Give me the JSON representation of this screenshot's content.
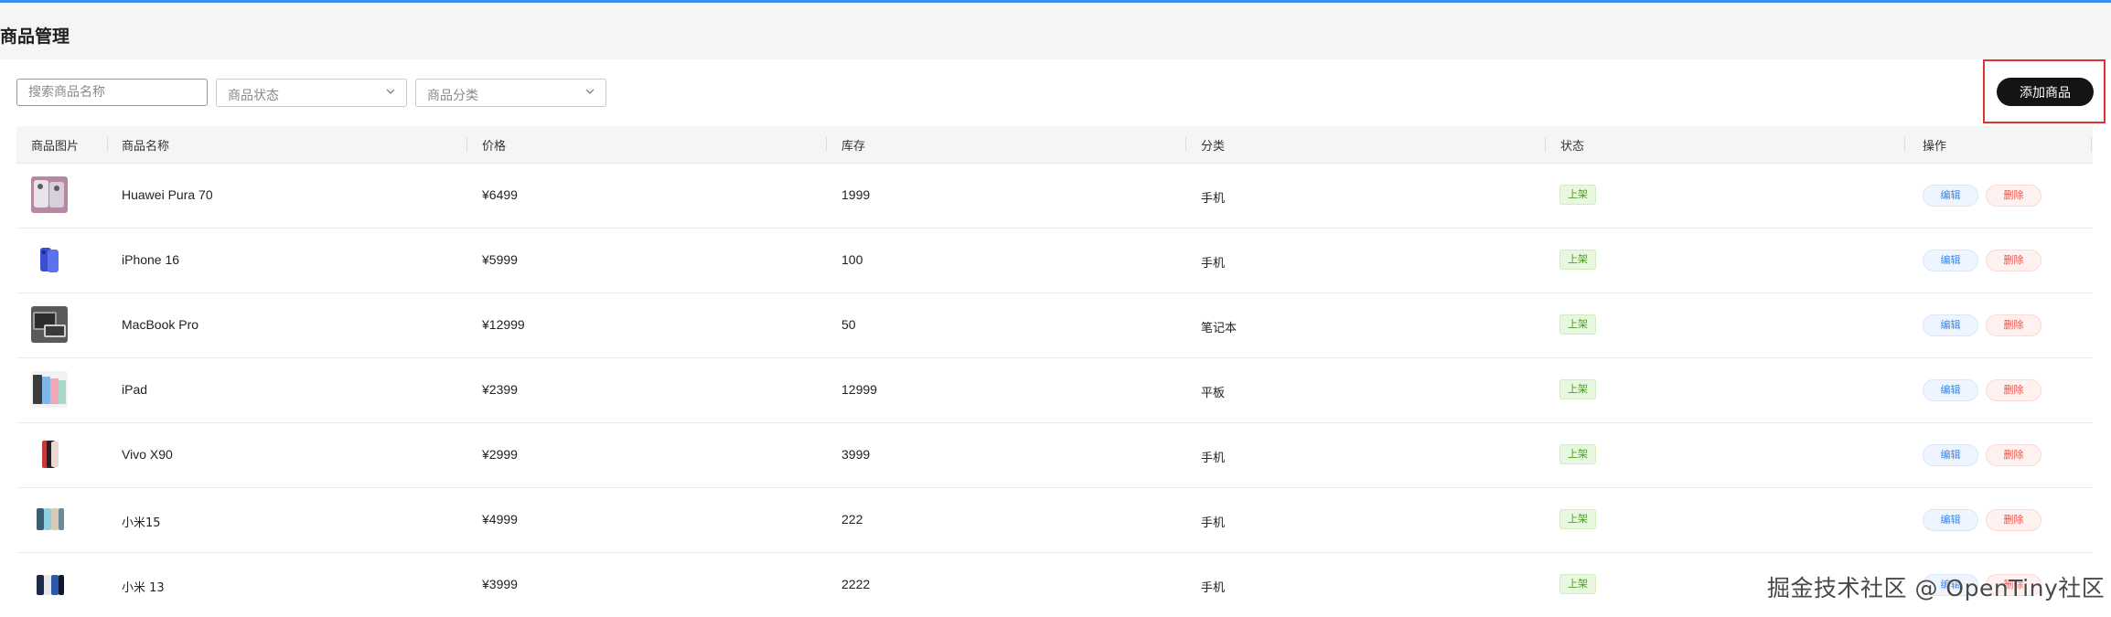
{
  "page": {
    "title": "商品管理",
    "accent_color": "#3b8ef0"
  },
  "filters": {
    "search_placeholder": "搜索商品名称",
    "status_placeholder": "商品状态",
    "category_placeholder": "商品分类"
  },
  "toolbar": {
    "add_label": "添加商品",
    "highlight_color": "#e03131"
  },
  "table": {
    "columns": [
      "商品图片",
      "商品名称",
      "价格",
      "库存",
      "分类",
      "状态",
      "操作"
    ],
    "rows": [
      {
        "name": "Huawei Pura 70",
        "price": "¥6499",
        "stock": "1999",
        "category": "手机",
        "status": "上架",
        "edit": "编辑",
        "delete": "删除",
        "thumb_icon": "phone-product-image"
      },
      {
        "name": "iPhone 16",
        "price": "¥5999",
        "stock": "100",
        "category": "手机",
        "status": "上架",
        "edit": "编辑",
        "delete": "删除",
        "thumb_icon": "phone-product-image"
      },
      {
        "name": "MacBook Pro",
        "price": "¥12999",
        "stock": "50",
        "category": "笔记本",
        "status": "上架",
        "edit": "编辑",
        "delete": "删除",
        "thumb_icon": "laptop-product-image"
      },
      {
        "name": "iPad",
        "price": "¥2399",
        "stock": "12999",
        "category": "平板",
        "status": "上架",
        "edit": "编辑",
        "delete": "删除",
        "thumb_icon": "tablet-product-image"
      },
      {
        "name": "Vivo X90",
        "price": "¥2999",
        "stock": "3999",
        "category": "手机",
        "status": "上架",
        "edit": "编辑",
        "delete": "删除",
        "thumb_icon": "phone-product-image"
      },
      {
        "name": "小米15",
        "price": "¥4999",
        "stock": "222",
        "category": "手机",
        "status": "上架",
        "edit": "编辑",
        "delete": "删除",
        "thumb_icon": "phone-product-image"
      },
      {
        "name": "小米 13",
        "price": "¥3999",
        "stock": "2222",
        "category": "手机",
        "status": "上架",
        "edit": "编辑",
        "delete": "删除",
        "thumb_icon": "phone-product-image"
      }
    ]
  },
  "watermark": "掘金技术社区 @ OpenTiny社区"
}
